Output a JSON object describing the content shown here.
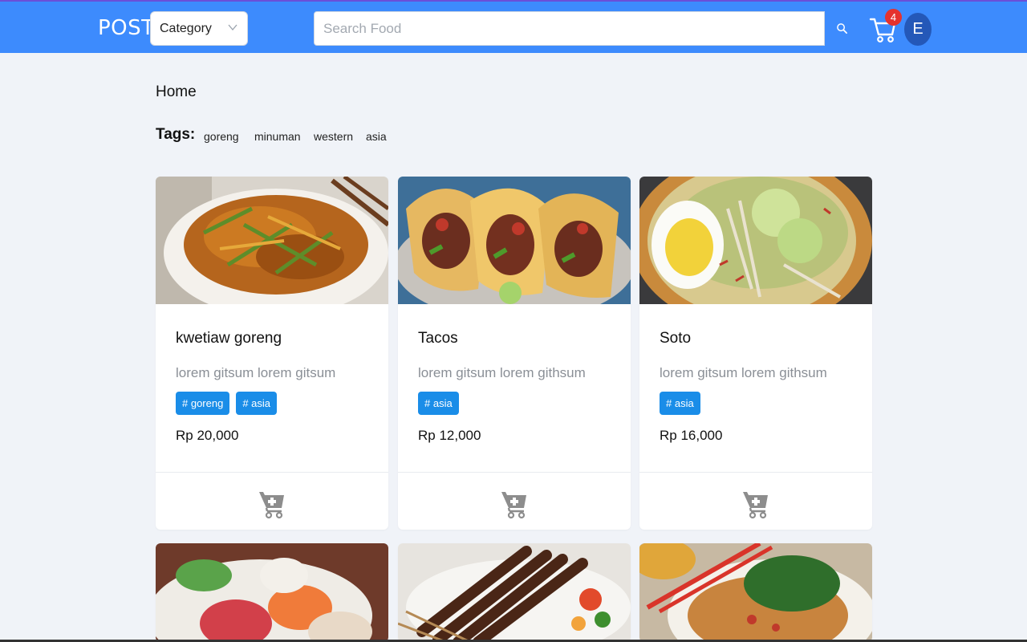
{
  "navbar": {
    "brand": "POST",
    "category_select": {
      "value": "Category"
    },
    "search": {
      "placeholder": "Search Food",
      "value": ""
    },
    "cart_count": "4",
    "avatar_initial": "E",
    "color": "#3d8bfd"
  },
  "breadcrumb": "Home",
  "tags": {
    "label": "Tags:",
    "items": [
      "goreng",
      "minuman",
      "western",
      "asia"
    ]
  },
  "products": [
    {
      "name": "kwetiaw goreng",
      "description": "lorem gitsum lorem gitsum",
      "tags": [
        "# goreng",
        "# asia"
      ],
      "price": "Rp 20,000",
      "image": "fried-noodles-photo"
    },
    {
      "name": "Tacos",
      "description": "lorem gitsum lorem githsum",
      "tags": [
        "# asia"
      ],
      "price": "Rp 12,000",
      "image": "tacos-photo"
    },
    {
      "name": "Soto",
      "description": "lorem gitsum lorem githsum",
      "tags": [
        "# asia"
      ],
      "price": "Rp 16,000",
      "image": "soto-soup-photo"
    }
  ],
  "more_products_images": [
    "sashimi-photo",
    "satay-photo",
    "mie-ayam-photo"
  ],
  "colors": {
    "tag_pill": "#1a8de8",
    "badge": "#e5322d",
    "avatar": "#2458b8"
  }
}
